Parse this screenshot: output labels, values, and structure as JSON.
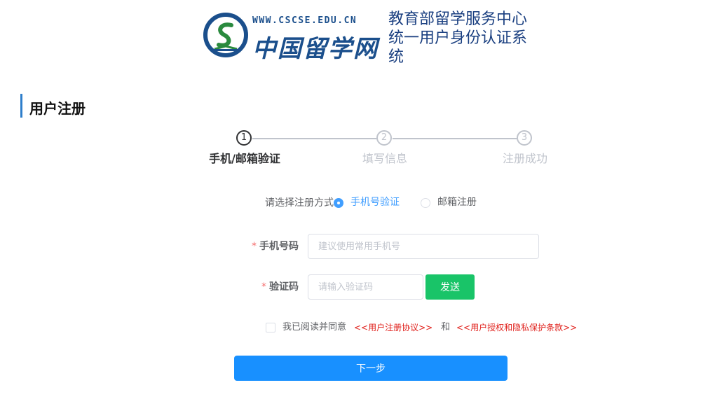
{
  "header": {
    "logo_url": "WWW.CSCSE.EDU.CN",
    "logo_name": "中国留学网",
    "title": "教育部留学服务中心统一用户身份认证系统"
  },
  "section_title": "用户注册",
  "steps": [
    {
      "number": "1",
      "label": "手机/邮箱验证",
      "active": true
    },
    {
      "number": "2",
      "label": "填写信息",
      "active": false
    },
    {
      "number": "3",
      "label": "注册成功",
      "active": false
    }
  ],
  "method": {
    "label": "请选择注册方式",
    "options": [
      {
        "label": "手机号验证",
        "checked": true
      },
      {
        "label": "邮箱注册",
        "checked": false
      }
    ]
  },
  "form": {
    "required_mark": "*",
    "phone": {
      "label": "手机号码",
      "value": "",
      "placeholder": "建议使用常用手机号"
    },
    "code": {
      "label": "验证码",
      "value": "",
      "placeholder": "请输入验证码"
    },
    "send_button": "发送"
  },
  "agreement": {
    "checked": false,
    "prefix": "我已阅读并同意",
    "link1": "<<用户注册协议>>",
    "conjunction": "和",
    "link2": "<<用户授权和隐私保护条款>>"
  },
  "next_button": "下一步",
  "colors": {
    "primary": "#1890ff",
    "send": "#19c468",
    "link": "#e0201b",
    "brand": "#1b4f8c"
  }
}
